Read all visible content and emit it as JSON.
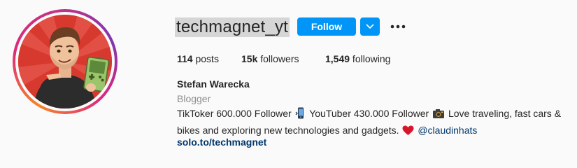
{
  "profile": {
    "username": "techmagnet_yt",
    "follow_label": "Follow",
    "stats": {
      "posts_count": "114",
      "posts_label": " posts",
      "followers_count": "15k",
      "followers_label": " followers",
      "following_count": "1,549",
      "following_label": " following"
    },
    "full_name": "Stefan Warecka",
    "category": "Blogger",
    "bio": {
      "line1_part1": "TikToker 600.000 Follower ",
      "line1_part2": " YouTuber 430.000 Follower ",
      "line1_part3": " Love traveling, fast cars & ",
      "line2": "bikes and exploring new technologies and gadgets. ",
      "mention": "@claudinhats"
    },
    "website": "solo.to/techmagnet"
  },
  "icons": {
    "dropdown": "chevron-down-icon",
    "more": "more-options-icon",
    "phone": "mobile-phone-emoji",
    "camera": "camera-emoji",
    "heart": "red-heart-emoji"
  },
  "colors": {
    "primary_button": "#0095f6",
    "link": "#00376b",
    "secondary_text": "#8e8e8e",
    "username_highlight": "#d6d6d6",
    "avatar_background": "#d8392f"
  }
}
